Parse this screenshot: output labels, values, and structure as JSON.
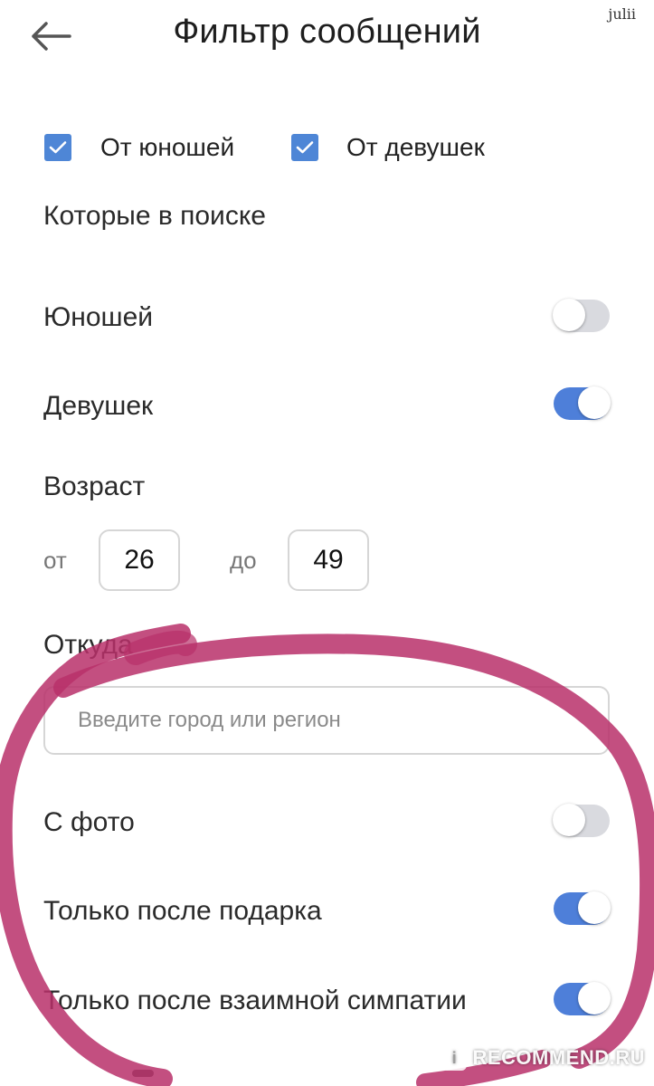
{
  "header": {
    "title": "Фильтр сообщений",
    "watermark_user": "julii"
  },
  "from": {
    "boys_label": "От юношей",
    "girls_label": "От девушек",
    "boys_checked": true,
    "girls_checked": true
  },
  "searching": {
    "title": "Которые в поиске",
    "boys_label": "Юношей",
    "boys_on": false,
    "girls_label": "Девушек",
    "girls_on": true
  },
  "age": {
    "title": "Возраст",
    "from_prefix": "от",
    "from_value": "26",
    "to_prefix": "до",
    "to_value": "49"
  },
  "location": {
    "title": "Откуда",
    "placeholder": "Введите город или регион"
  },
  "options": {
    "with_photo_label": "С фото",
    "with_photo_on": false,
    "after_gift_label": "Только после подарка",
    "after_gift_on": true,
    "after_mutual_label": "Только после взаимной симпатии",
    "after_mutual_on": true
  },
  "watermark": {
    "text": "RECOMMEND.RU",
    "badge_glyph": "i"
  },
  "colors": {
    "accent": "#4e7fd9",
    "checkbox": "#4e86d6",
    "toggle_off": "#d9dadf",
    "marker": "#b8306a"
  },
  "icons": {
    "back": "arrow-left-icon",
    "check": "checkmark-icon"
  }
}
